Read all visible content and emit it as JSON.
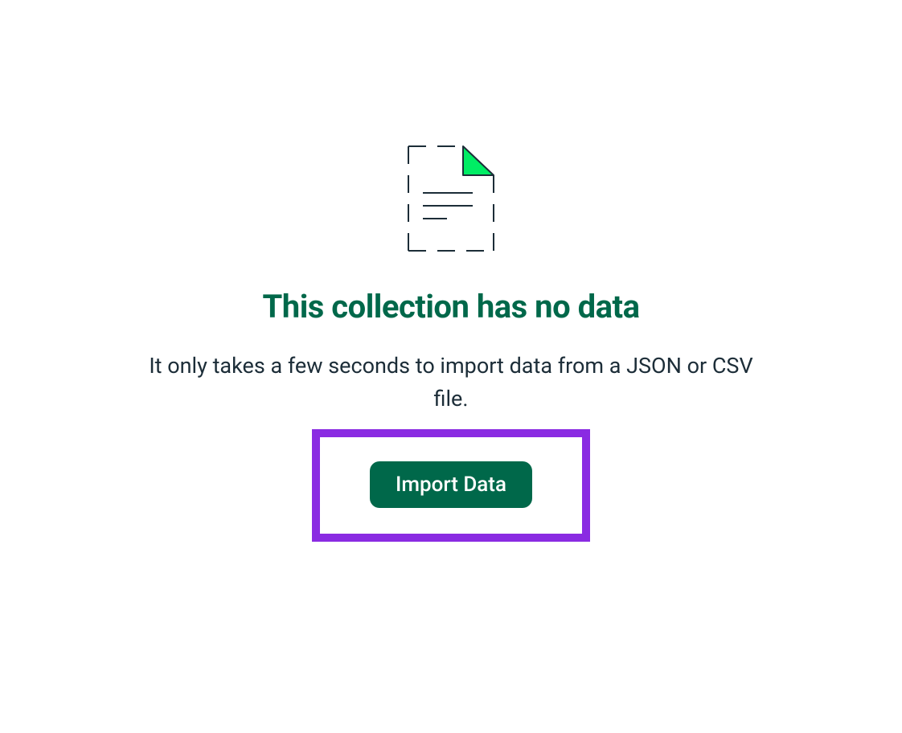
{
  "emptyState": {
    "heading": "This collection has no data",
    "description": "It only takes a few seconds to import data from a JSON or CSV file.",
    "buttonLabel": "Import Data"
  },
  "colors": {
    "primary": "#00684A",
    "accent": "#00ED64",
    "highlight": "#8A2BE2",
    "text": "#1C2D38"
  }
}
